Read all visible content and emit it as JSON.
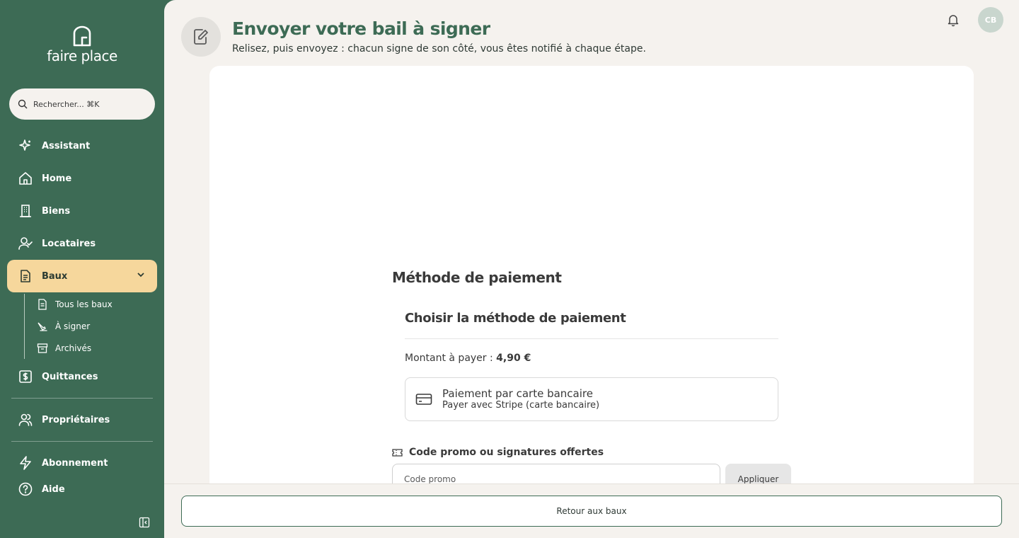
{
  "sidebar": {
    "brand": "faire place",
    "search_placeholder": "Rechercher... ⌘K",
    "items": [
      {
        "label": "Assistant",
        "icon": "sparkle-icon"
      },
      {
        "label": "Home",
        "icon": "home-icon"
      },
      {
        "label": "Biens",
        "icon": "building-icon"
      },
      {
        "label": "Locataires",
        "icon": "user-check-icon"
      },
      {
        "label": "Baux",
        "icon": "document-icon",
        "active": true
      },
      {
        "label": "Quittances",
        "icon": "receipt-dollar-icon"
      },
      {
        "label": "Propriétaires",
        "icon": "users-icon"
      },
      {
        "label": "Abonnement",
        "icon": "lightning-icon"
      },
      {
        "label": "Aide",
        "icon": "help-circle-icon"
      }
    ],
    "sub_items": [
      {
        "label": "Tous les baux",
        "icon": "document-icon"
      },
      {
        "label": "À signer",
        "icon": "signature-icon"
      },
      {
        "label": "Archivés",
        "icon": "archive-icon"
      }
    ]
  },
  "header": {
    "title": "Envoyer votre bail à signer",
    "subtitle": "Relisez, puis envoyez : chacun signe de son côté, vous êtes notifié à chaque étape.",
    "avatar_initials": "CB"
  },
  "payment": {
    "title": "Méthode de paiement",
    "subtitle": "Choisir la méthode de paiement",
    "amount_label": "Montant à payer :",
    "amount_value": "4,90 €",
    "option_title": "Paiement par carte bancaire",
    "option_desc": "Payer avec Stripe (carte bancaire)",
    "promo_label": "Code promo ou signatures offertes",
    "promo_placeholder": "Code promo",
    "apply_label": "Appliquer"
  },
  "footer": {
    "back_label": "Retour aux baux"
  },
  "colors": {
    "sidebar_bg": "#3d6b55",
    "active_item": "#f6d79c",
    "page_bg": "#f5f2ee",
    "title_green": "#3d6b55"
  }
}
